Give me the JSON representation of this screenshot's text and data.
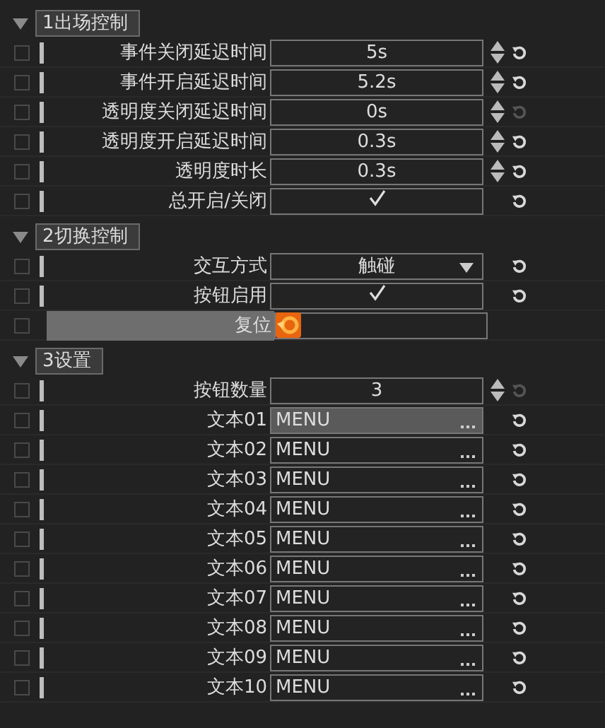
{
  "sections": [
    {
      "title": "1出场控制",
      "expanded": true,
      "rows": [
        {
          "kind": "number",
          "row_checked": false,
          "label": "事件关闭延迟时间",
          "value": "5s",
          "reset_enabled": true
        },
        {
          "kind": "number",
          "row_checked": false,
          "label": "事件开启延迟时间",
          "value": "5.2s",
          "reset_enabled": true
        },
        {
          "kind": "number",
          "row_checked": false,
          "label": "透明度关闭延迟时间",
          "value": "0s",
          "reset_enabled": false
        },
        {
          "kind": "number",
          "row_checked": false,
          "label": "透明度开启延迟时间",
          "value": "0.3s",
          "reset_enabled": true
        },
        {
          "kind": "number",
          "row_checked": false,
          "label": "透明度时长",
          "value": "0.3s",
          "reset_enabled": true
        },
        {
          "kind": "check",
          "row_checked": false,
          "label": "总开启/关闭",
          "checked": true,
          "reset_enabled": true
        }
      ]
    },
    {
      "title": "2切换控制",
      "expanded": true,
      "rows": [
        {
          "kind": "dropdown",
          "row_checked": false,
          "label": "交互方式",
          "value": "触碰",
          "reset_enabled": true
        },
        {
          "kind": "check",
          "row_checked": false,
          "label": "按钮启用",
          "checked": true,
          "reset_enabled": true
        },
        {
          "kind": "button",
          "row_checked": false,
          "label": "复位"
        }
      ]
    },
    {
      "title": "3设置",
      "expanded": true,
      "rows": [
        {
          "kind": "number",
          "row_checked": false,
          "label": "按钮数量",
          "value": "3",
          "reset_enabled": false
        },
        {
          "kind": "text",
          "row_checked": false,
          "label": "文本01",
          "value": "MENU",
          "selected": true,
          "reset_enabled": true
        },
        {
          "kind": "text",
          "row_checked": false,
          "label": "文本02",
          "value": "MENU",
          "selected": false,
          "reset_enabled": true
        },
        {
          "kind": "text",
          "row_checked": false,
          "label": "文本03",
          "value": "MENU",
          "selected": false,
          "reset_enabled": true
        },
        {
          "kind": "text",
          "row_checked": false,
          "label": "文本04",
          "value": "MENU",
          "selected": false,
          "reset_enabled": true
        },
        {
          "kind": "text",
          "row_checked": false,
          "label": "文本05",
          "value": "MENU",
          "selected": false,
          "reset_enabled": true
        },
        {
          "kind": "text",
          "row_checked": false,
          "label": "文本06",
          "value": "MENU",
          "selected": false,
          "reset_enabled": true
        },
        {
          "kind": "text",
          "row_checked": false,
          "label": "文本07",
          "value": "MENU",
          "selected": false,
          "reset_enabled": true
        },
        {
          "kind": "text",
          "row_checked": false,
          "label": "文本08",
          "value": "MENU",
          "selected": false,
          "reset_enabled": true
        },
        {
          "kind": "text",
          "row_checked": false,
          "label": "文本09",
          "value": "MENU",
          "selected": false,
          "reset_enabled": true
        },
        {
          "kind": "text",
          "row_checked": false,
          "label": "文本10",
          "value": "MENU",
          "selected": false,
          "reset_enabled": true
        }
      ]
    }
  ]
}
